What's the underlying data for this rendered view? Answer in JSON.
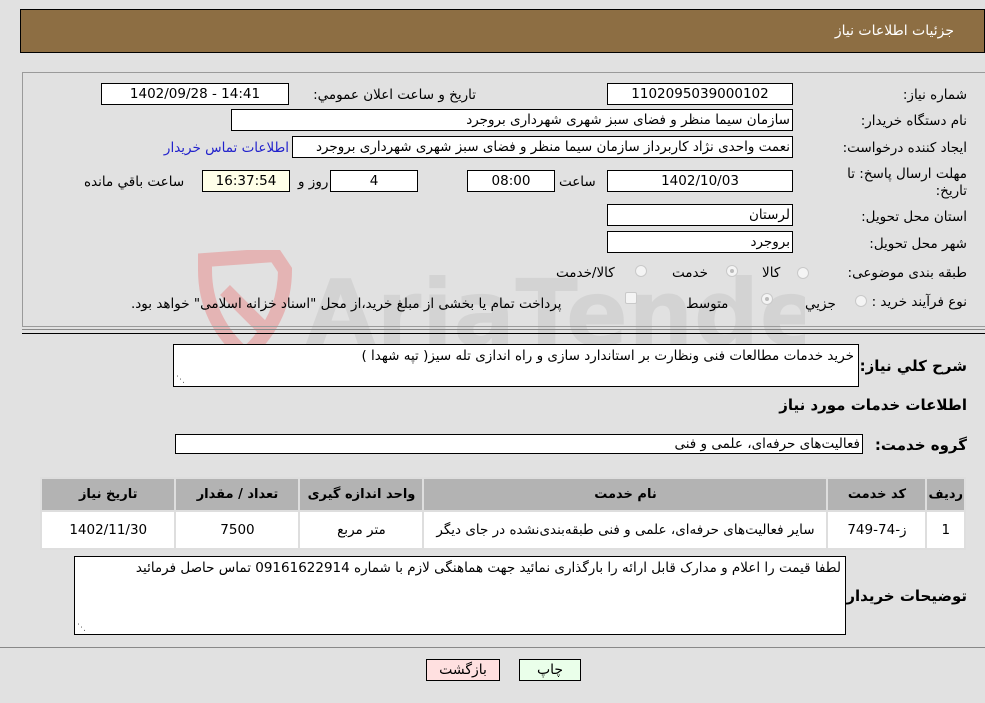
{
  "header": {
    "title": "جزئیات اطلاعات نیاز"
  },
  "fields": {
    "need_number": {
      "label": "شماره نیاز:",
      "value": "1102095039000102"
    },
    "announce_datetime": {
      "label": "تاریخ و ساعت اعلان عمومي:",
      "value": "1402/09/28 - 14:41"
    },
    "buyer_org": {
      "label": "نام دستگاه خريدار:",
      "value": "سازمان سیما منظر و فضای سبز شهری شهرداری بروجرد"
    },
    "requester": {
      "label": "ایجاد کننده درخواست:",
      "value": "نعمت واحدی نژاد کاربرداز سازمان سیما منظر و فضای سبز شهری شهرداری بروجرد",
      "contact_link": "اطلاعات تماس خریدار"
    },
    "deadline": {
      "label": "مهلت ارسال پاسخ: تا تاریخ:",
      "date": "1402/10/03",
      "time_label": "ساعت",
      "time": "08:00",
      "days": "4",
      "days_label": "روز و",
      "remaining": "16:37:54",
      "remaining_label": "ساعت باقي مانده"
    },
    "province": {
      "label": "استان محل تحویل:",
      "value": "لرستان"
    },
    "city": {
      "label": "شهر محل تحویل:",
      "value": "بروجرد"
    },
    "category": {
      "label": "طبقه بندی موضوعی:",
      "options": [
        "کالا",
        "خدمت",
        "کالا/خدمت"
      ],
      "selected": "خدمت"
    },
    "purchase_type": {
      "label": "نوع فرآیند خرید :",
      "options": [
        "جزيي",
        "متوسط"
      ],
      "selected": "متوسط",
      "treasury_note": "پرداخت تمام یا بخشی از مبلغ خرید،از محل \"اسناد خزانه اسلامی\" خواهد بود."
    }
  },
  "description": {
    "label": "شرح کلي نياز:",
    "value": "خرید خدمات مطالعات فنی ونظارت بر استاندارد سازی و راه اندازی تله سیز( تپه شهدا )"
  },
  "services_section": {
    "title": "اطلاعات خدمات مورد نياز",
    "group_label": "گروه خدمت:",
    "group_value": "فعالیت‌های حرفه‌ای، علمی و فنی"
  },
  "table": {
    "headers": [
      "ردیف",
      "کد خدمت",
      "نام خدمت",
      "واحد اندازه گیری",
      "تعداد / مقدار",
      "تاریخ نیاز"
    ],
    "rows": [
      {
        "row": "1",
        "code": "ز-74-749",
        "name": "سایر فعالیت‌های حرفه‌ای، علمی و فنی طبقه‌بندی‌نشده در جای دیگر",
        "unit": "متر مربع",
        "quantity": "7500",
        "date": "1402/11/30"
      }
    ]
  },
  "buyer_notes": {
    "label": "توضیحات خریدار:",
    "value": "لطفا قیمت را اعلام و مدارک قابل ارائه را بارگذاری نمائید جهت هماهنگی لازم با شماره 09161622914 تماس حاصل فرمائید"
  },
  "buttons": {
    "print": "چاپ",
    "back": "بازگشت"
  },
  "watermark": {
    "text": "AriaTender.neT"
  },
  "colors": {
    "header_bg": "#8d6e43",
    "print_bg": "#eaffea",
    "back_bg": "#ffe0e0",
    "link": "#2222cc"
  }
}
